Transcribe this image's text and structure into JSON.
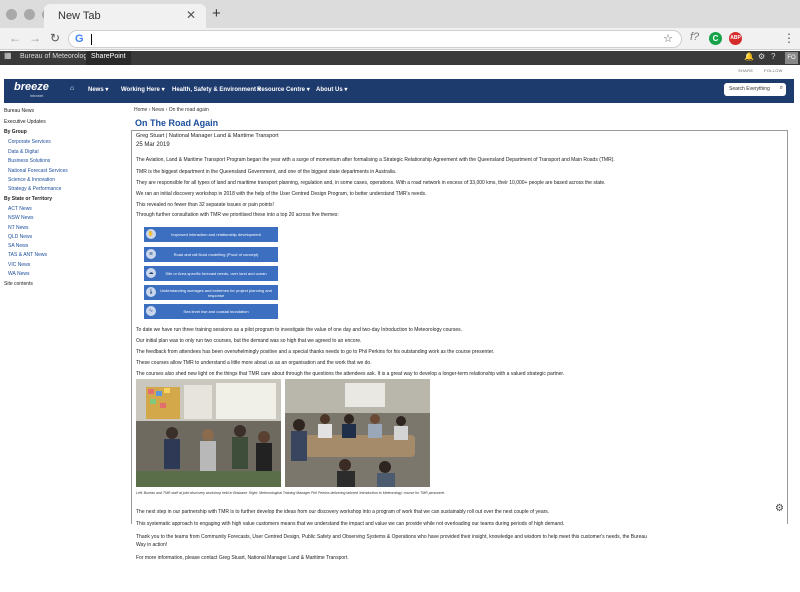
{
  "browser": {
    "tab_title": "New Tab",
    "tab_close": "✕",
    "new_tab": "+",
    "back": "←",
    "forward": "→",
    "reload": "↻",
    "star": "☆",
    "fx": "f?",
    "ext_green": "C",
    "ext_red": "ABP",
    "menu": "⋮",
    "icons": [
      "back-arrow-icon",
      "forward-arrow-icon",
      "reload-icon",
      "google-icon",
      "star-icon",
      "menu-icon"
    ]
  },
  "suitebar": {
    "site_link": "Bureau of Meteorology",
    "app": "SharePoint",
    "avatar": "FO",
    "share": "SHARE",
    "follow": "FOLLOW"
  },
  "header": {
    "logo": "breeze",
    "logo_sub": "intranet",
    "nav": [
      "News",
      "Working Here",
      "Health, Safety & Environment",
      "Resource Centre",
      "About Us"
    ],
    "search_placeholder": "Search Everything"
  },
  "leftnav": {
    "items": [
      {
        "label": "Bureau News",
        "type": "link"
      },
      {
        "label": "Executive Updates",
        "type": "link"
      },
      {
        "label": "By Group",
        "type": "head"
      },
      {
        "label": "Corporate Services",
        "type": "sub"
      },
      {
        "label": "Data & Digital",
        "type": "sub"
      },
      {
        "label": "Business Solutions",
        "type": "sub"
      },
      {
        "label": "National Forecast Services",
        "type": "sub"
      },
      {
        "label": "Science & Innovation",
        "type": "sub"
      },
      {
        "label": "Strategy & Performance",
        "type": "sub"
      },
      {
        "label": "By State or Territory",
        "type": "head"
      },
      {
        "label": "ACT News",
        "type": "sub"
      },
      {
        "label": "NSW News",
        "type": "sub"
      },
      {
        "label": "NT News",
        "type": "sub"
      },
      {
        "label": "QLD News",
        "type": "sub"
      },
      {
        "label": "SA News",
        "type": "sub"
      },
      {
        "label": "TAS & ANT News",
        "type": "sub"
      },
      {
        "label": "VIC News",
        "type": "sub"
      },
      {
        "label": "WA News",
        "type": "sub"
      },
      {
        "label": "Site contents",
        "type": "link"
      }
    ]
  },
  "article": {
    "breadcrumb": "Home  ›  News  ›  On the road again",
    "title": "On The Road Again",
    "author": "Greg Stuart | National Manager Land & Maritime Transport",
    "date": "25 Mar 2019",
    "paragraphs": [
      "The Aviation, Land & Maritime Transport Program began the year with a surge of momentum after formalising a Strategic Relationship Agreement with the Queensland Department of Transport and Main Roads (TMR).",
      "TMR is the biggest department in the Queensland Government, and one of the biggest state departments in Australia.",
      "They are responsible for all types of land and maritime transport planning, regulation and, in some cases, operations. With a road network in excess of 33,000 kms, their 10,000+ people are based across the state.",
      "We ran an initial discovery workshop in 2018 with the help of the User Centred Design Program, to better understand TMR's needs.",
      "This revealed no fewer than 32 separate issues or pain points!",
      "Through further consultation with TMR we prioritised these into a top 20 across five themes:"
    ],
    "themes": [
      {
        "label": "Improved interaction and relationship development",
        "icon": "handshake-icon"
      },
      {
        "label": "Road and rail flood modelling (Proof of concept)",
        "icon": "flood-icon"
      },
      {
        "label": "Site or Area specific forecast needs, over land and ocean",
        "icon": "weather-icon"
      },
      {
        "label": "Understanding averages and extremes for project planning and response",
        "icon": "thermometer-icon"
      },
      {
        "label": "Sea level rise and coastal inundation",
        "icon": "wave-icon"
      }
    ],
    "paragraphs2": [
      "To date we have run three training sessions as a pilot program to investigate the value of one day and two-day Introduction to Meteorology courses.",
      "Our initial plan was to only run two courses, but the demand was so high that we agreed to an encore.",
      "The feedback from attendees has been overwhelmingly positive and a special thanks needs to go to Phil Perkins for his outstanding work as the course presenter.",
      "These courses allow TMR to understand a little more about us as an organisation and the work that we do.",
      "The courses also shed new light on the things that TMR care about through the questions the attendees ask. It is a great way to develop a longer-term relationship with a valued strategic partner."
    ],
    "caption": "Left: Bureau and TMR staff at joint discovery workshop held in Brisbane. Right: Meteorological Training Manager Phil Perkins delivering tailored 'Introduction to Meteorology' course for TMR personnel.",
    "paragraphs3": [
      "The next step in our partnership with TMR is to further develop the ideas from our discovery workshop into a program of work that we can sustainably roll out over the next couple of years.",
      "This systematic approach to engaging with high value customers means that we understand the impact and value we can provide while not overloading our teams during periods of high demand.",
      "Thank you to the teams from Community Forecasts, User Centred Design, Public Safety and Observing Systems & Operations who have provided their insight, knowledge and wisdom to help meet this customer's needs, the Bureau",
      "Way in action!",
      "For more information, please contact Greg Stuart, National Manager Land & Maritime Transport."
    ]
  }
}
